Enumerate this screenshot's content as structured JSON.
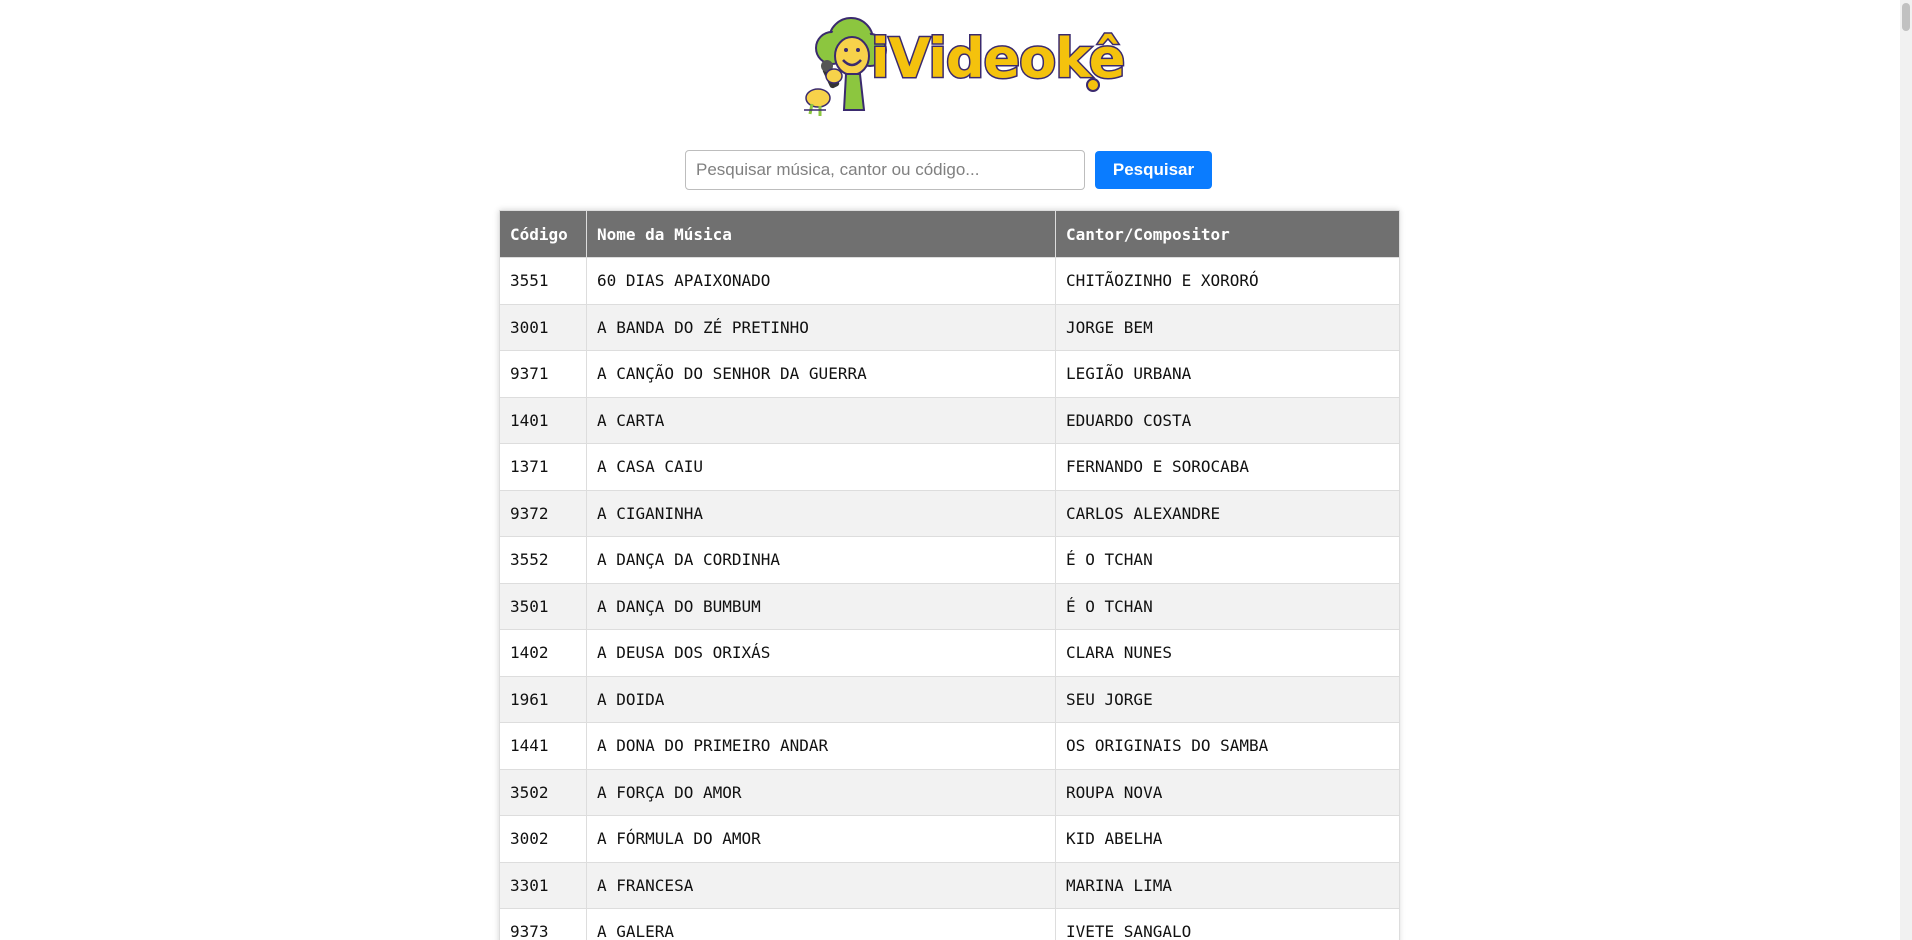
{
  "logo": {
    "text": "iVideokê"
  },
  "search": {
    "placeholder": "Pesquisar música, cantor ou código...",
    "value": "",
    "button_label": "Pesquisar"
  },
  "table": {
    "headers": {
      "code": "Código",
      "song": "Nome da Música",
      "artist": "Cantor/Compositor"
    },
    "rows": [
      {
        "code": "3551",
        "song": "60 DIAS APAIXONADO",
        "artist": "CHITÃOZINHO E XORORÓ"
      },
      {
        "code": "3001",
        "song": "A BANDA DO ZÉ PRETINHO",
        "artist": "JORGE BEM"
      },
      {
        "code": "9371",
        "song": "A CANÇÃO DO SENHOR DA GUERRA",
        "artist": "LEGIÃO URBANA"
      },
      {
        "code": "1401",
        "song": "A CARTA",
        "artist": "EDUARDO COSTA"
      },
      {
        "code": "1371",
        "song": "A CASA CAIU",
        "artist": "FERNANDO E SOROCABA"
      },
      {
        "code": "9372",
        "song": "A CIGANINHA",
        "artist": "CARLOS ALEXANDRE"
      },
      {
        "code": "3552",
        "song": "A DANÇA DA CORDINHA",
        "artist": "É O TCHAN"
      },
      {
        "code": "3501",
        "song": "A DANÇA DO BUMBUM",
        "artist": "É O TCHAN"
      },
      {
        "code": "1402",
        "song": "A DEUSA DOS ORIXÁS",
        "artist": "CLARA NUNES"
      },
      {
        "code": "1961",
        "song": "A DOIDA",
        "artist": "SEU JORGE"
      },
      {
        "code": "1441",
        "song": "A DONA DO PRIMEIRO ANDAR",
        "artist": "OS ORIGINAIS DO SAMBA"
      },
      {
        "code": "3502",
        "song": "A FORÇA DO AMOR",
        "artist": "ROUPA NOVA"
      },
      {
        "code": "3002",
        "song": "A FÓRMULA DO AMOR",
        "artist": "KID ABELHA"
      },
      {
        "code": "3301",
        "song": "A FRANCESA",
        "artist": "MARINA LIMA"
      },
      {
        "code": "9373",
        "song": "A GALERA",
        "artist": "IVETE SANGALO"
      }
    ]
  },
  "colors": {
    "header_bg": "#707070",
    "button_bg": "#0a7cff",
    "row_alt_bg": "#f2f2f2",
    "logo_yellow": "#f4c20d",
    "logo_outline": "#3a2a6e",
    "mascot_green": "#8cc63f"
  },
  "icons": {
    "logo_mascot": "karaoke-tree-mascot-icon"
  }
}
